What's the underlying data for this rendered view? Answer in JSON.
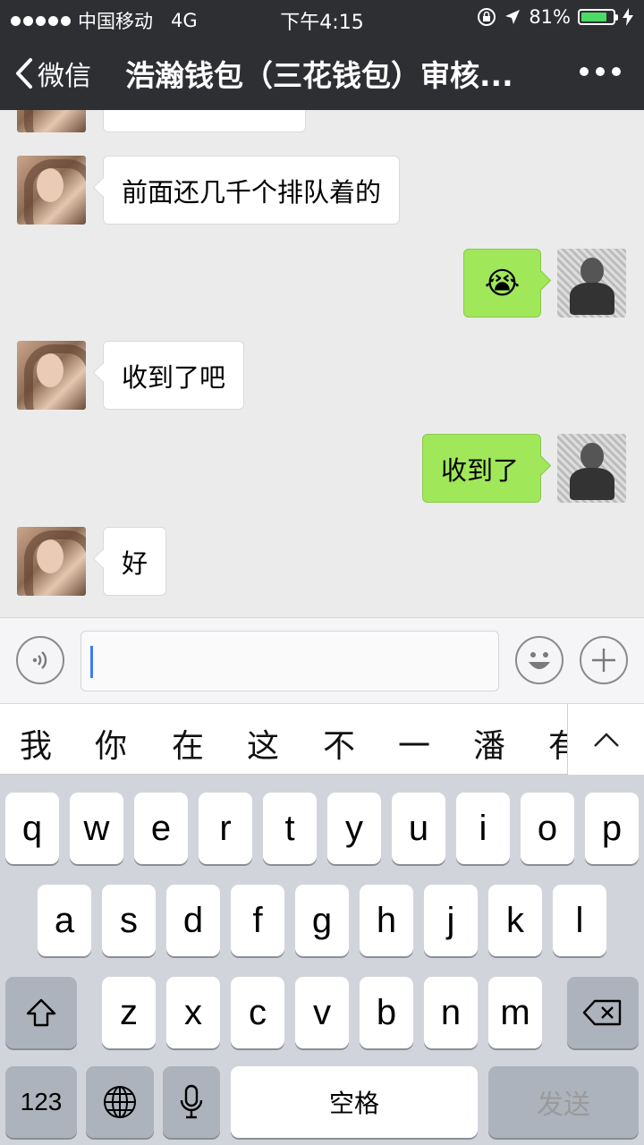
{
  "status": {
    "carrier": "中国移动",
    "network": "4G",
    "time": "下午4:15",
    "battery": "81%",
    "battery_level": 0.81
  },
  "nav": {
    "back_label": "微信",
    "title": "浩瀚钱包（三花钱包）审核..."
  },
  "messages": [
    {
      "side": "in",
      "text": ""
    },
    {
      "side": "in",
      "text": "前面还几千个排队着的"
    },
    {
      "side": "out",
      "text": "😭"
    },
    {
      "side": "in",
      "text": "收到了吧"
    },
    {
      "side": "out",
      "text": "收到了"
    },
    {
      "side": "in",
      "text": "好"
    }
  ],
  "input": {
    "value": "",
    "placeholder": ""
  },
  "candidates": [
    "我",
    "你",
    "在",
    "这",
    "不",
    "一",
    "潘",
    "有"
  ],
  "keyboard": {
    "row1": [
      "q",
      "w",
      "e",
      "r",
      "t",
      "y",
      "u",
      "i",
      "o",
      "p"
    ],
    "row2": [
      "a",
      "s",
      "d",
      "f",
      "g",
      "h",
      "j",
      "k",
      "l"
    ],
    "row3": [
      "z",
      "x",
      "c",
      "v",
      "b",
      "n",
      "m"
    ],
    "numbers_label": "123",
    "space_label": "空格",
    "send_label": "发送"
  },
  "icons": [
    "back-chevron-icon",
    "more-icon",
    "voice-icon",
    "emoji-icon",
    "plus-icon",
    "shift-icon",
    "backspace-icon",
    "globe-icon",
    "mic-icon",
    "chevron-up-icon"
  ]
}
